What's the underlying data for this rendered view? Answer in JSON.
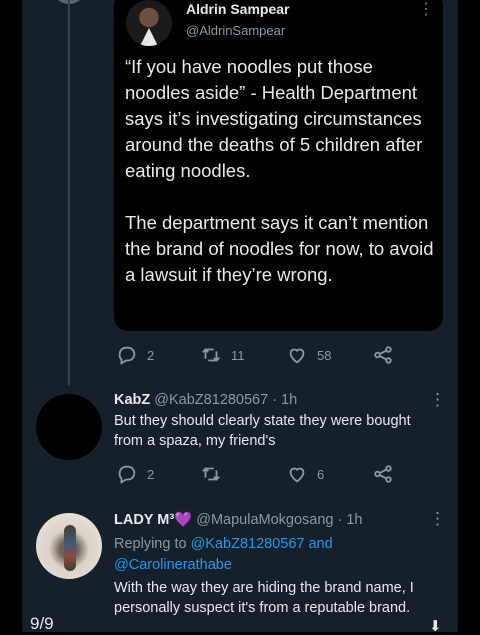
{
  "quoted_tweet": {
    "name": "Aldrin Sampear",
    "handle": "@AldrinSampear",
    "paragraph1": "“If you have noodles put those noodles aside” - Health Department says it’s investigating circumstances around the deaths of 5 children after eating noodles.",
    "paragraph2": "The department says it can’t mention the brand of noodles for now, to avoid a lawsuit if they’re wrong."
  },
  "main_actions": {
    "replies": "2",
    "retweets": "11",
    "likes": "58"
  },
  "reply1": {
    "name": "KabZ",
    "handle": "@KabZ81280567",
    "time": "· 1h",
    "text": "But they should clearly state they were bought from a spaza, my friend's",
    "replies": "2",
    "likes": "6"
  },
  "reply2": {
    "name": "LADY M³💜",
    "handle": "@MapulaMokgosang",
    "time": "· 1h",
    "replying_prefix": "Replying to",
    "replying_to": "@KabZ81280567 and @Carolinerathabe",
    "text": "With the way they are hiding the brand name, I personally suspect it's from a reputable brand."
  },
  "pager": {
    "counter": "9/9"
  },
  "icons": {
    "reply": "reply-icon",
    "retweet": "retweet-icon",
    "like": "heart-icon",
    "share": "share-icon",
    "more": "more-icon",
    "down": "down-arrow-icon"
  }
}
